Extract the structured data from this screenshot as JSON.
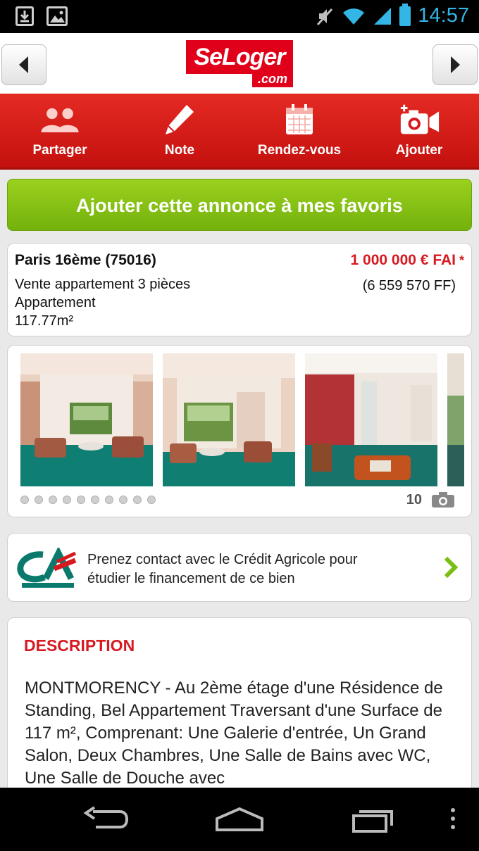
{
  "status_bar": {
    "time": "14:57",
    "icons": [
      "download-icon",
      "image-icon",
      "mute-icon",
      "wifi-icon",
      "signal-icon",
      "battery-icon"
    ]
  },
  "header": {
    "logo_main": "SeLoger",
    "logo_sub": ".com",
    "back_icon": "chevron-left-icon",
    "forward_icon": "chevron-right-icon"
  },
  "actions": [
    {
      "label": "Partager",
      "icon": "people-icon"
    },
    {
      "label": "Note",
      "icon": "pencil-icon"
    },
    {
      "label": "Rendez-vous",
      "icon": "calendar-icon"
    },
    {
      "label": "Ajouter",
      "icon": "add-camera-icon"
    }
  ],
  "favorites_button": "Ajouter cette annonce à mes favoris",
  "listing": {
    "location": "Paris 16ème (75016)",
    "price": "1 000 000 € FAI",
    "price_marker": "*",
    "price_ff": "(6 559 570 FF)",
    "type": "Vente appartement 3 pièces",
    "category": "Appartement",
    "surface": "117.77m²"
  },
  "gallery": {
    "photo_count": "10",
    "page_dots": 10
  },
  "credit": {
    "logo_text": "CA",
    "line1": "Prenez contact avec le Crédit Agricole pour",
    "line2": "étudier le financement de ce bien"
  },
  "description": {
    "title": "DESCRIPTION",
    "text": "MONTMORENCY - Au 2ème étage d'une Résidence de Standing, Bel Appartement Traversant d'une Surface de 117 m², Comprenant: Une Galerie d'entrée, Un Grand Salon, Deux Chambres, Une Salle de Bains avec WC, Une Salle de Douche avec"
  },
  "colors": {
    "brand_red": "#e1001a",
    "action_bar_red": "#d71920",
    "favorites_green": "#86c216",
    "status_blue": "#33b5e5"
  }
}
